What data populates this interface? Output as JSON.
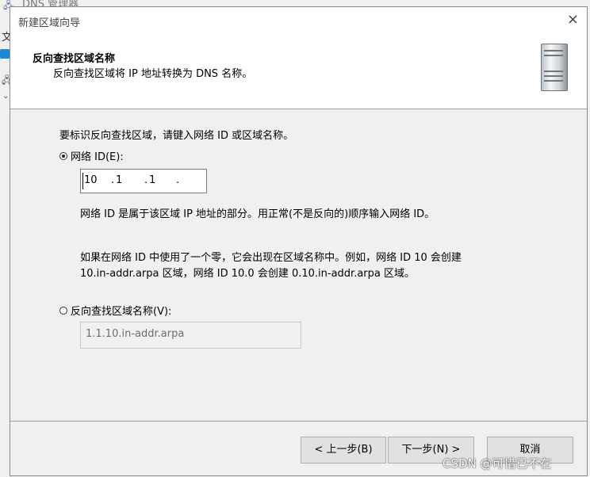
{
  "background": {
    "window_title": "DNS 管理器",
    "menu_initial": "文"
  },
  "dialog": {
    "title": "新建区域向导",
    "close_symbol": "×",
    "header": {
      "title": "反向查找区域名称",
      "subtitle": "反向查找区域将 IP 地址转换为 DNS 名称。"
    },
    "instruction": "要标识反向查找区域，请键入网络 ID 或区域名称。",
    "network_id_option": {
      "label": "网络 ID(E):",
      "selected": true,
      "octets": [
        "10",
        "1",
        "1",
        ""
      ],
      "separator": "."
    },
    "network_id_help": "网络 ID 是属于该区域 IP 地址的部分。用正常(不是反向的)顺序输入网络 ID。",
    "zero_note_line1": "如果在网络 ID 中使用了一个零，它会出现在区域名称中。例如，网络 ID 10 会创建",
    "zero_note_line2": "10.in-addr.arpa 区域，网络 ID 10.0 会创建 0.10.in-addr.arpa 区域。",
    "zone_name_option": {
      "label": "反向查找区域名称(V):",
      "selected": false,
      "value": "1.1.10.in-addr.arpa"
    },
    "buttons": {
      "back": "< 上一步(B)",
      "next": "下一步(N) >",
      "cancel": "取消"
    }
  },
  "watermark": "CSDN @可惜已不在"
}
